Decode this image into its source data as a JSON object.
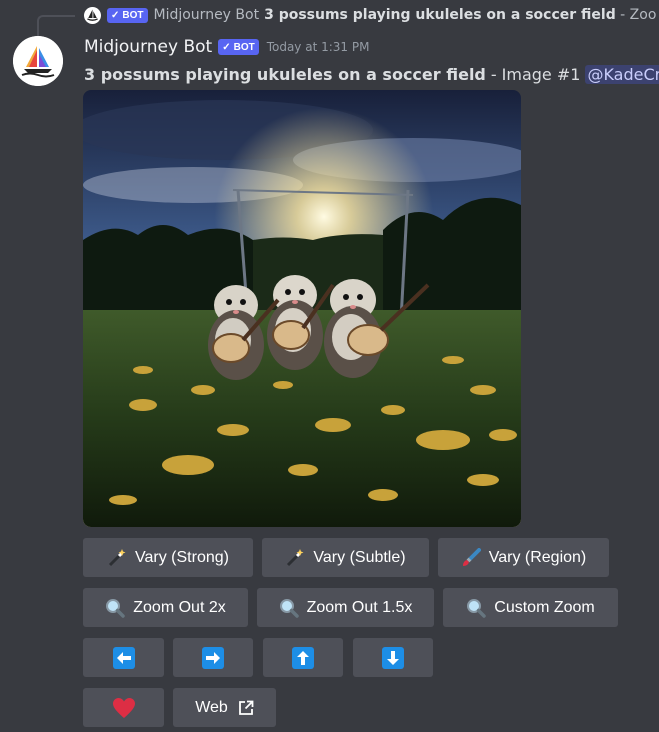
{
  "reply": {
    "bot_tag": "BOT",
    "author": "Midjourney Bot",
    "prompt": "3 possums playing ukuleles on a soccer field",
    "trailing": " - Zoo"
  },
  "message": {
    "author": "Midjourney Bot",
    "bot_tag": "BOT",
    "timestamp": "Today at 1:31 PM",
    "prompt": "3 possums playing ukuleles on a soccer field",
    "separator": "-",
    "suffix": "Image #1",
    "mention": "@KadeCry"
  },
  "buttons": {
    "row1": [
      {
        "label": "Vary (Strong)",
        "icon": "magic-wand-icon"
      },
      {
        "label": "Vary (Subtle)",
        "icon": "magic-wand-icon"
      },
      {
        "label": "Vary (Region)",
        "icon": "paintbrush-icon"
      }
    ],
    "row2": [
      {
        "label": "Zoom Out 2x",
        "icon": "magnifier-icon"
      },
      {
        "label": "Zoom Out 1.5x",
        "icon": "magnifier-icon"
      },
      {
        "label": "Custom Zoom",
        "icon": "magnifier-icon"
      }
    ],
    "row3": [
      {
        "icon": "arrow-left-icon"
      },
      {
        "icon": "arrow-right-icon"
      },
      {
        "icon": "arrow-up-icon"
      },
      {
        "icon": "arrow-down-icon"
      }
    ],
    "row4": [
      {
        "icon": "heart-icon"
      },
      {
        "label": "Web",
        "icon": "external-link-icon"
      }
    ]
  },
  "colors": {
    "background": "#383a40",
    "button": "#4e5058",
    "bot_tag": "#5865f2",
    "arrow_blue": "#1d8ee6",
    "heart": "#dd2e44"
  }
}
